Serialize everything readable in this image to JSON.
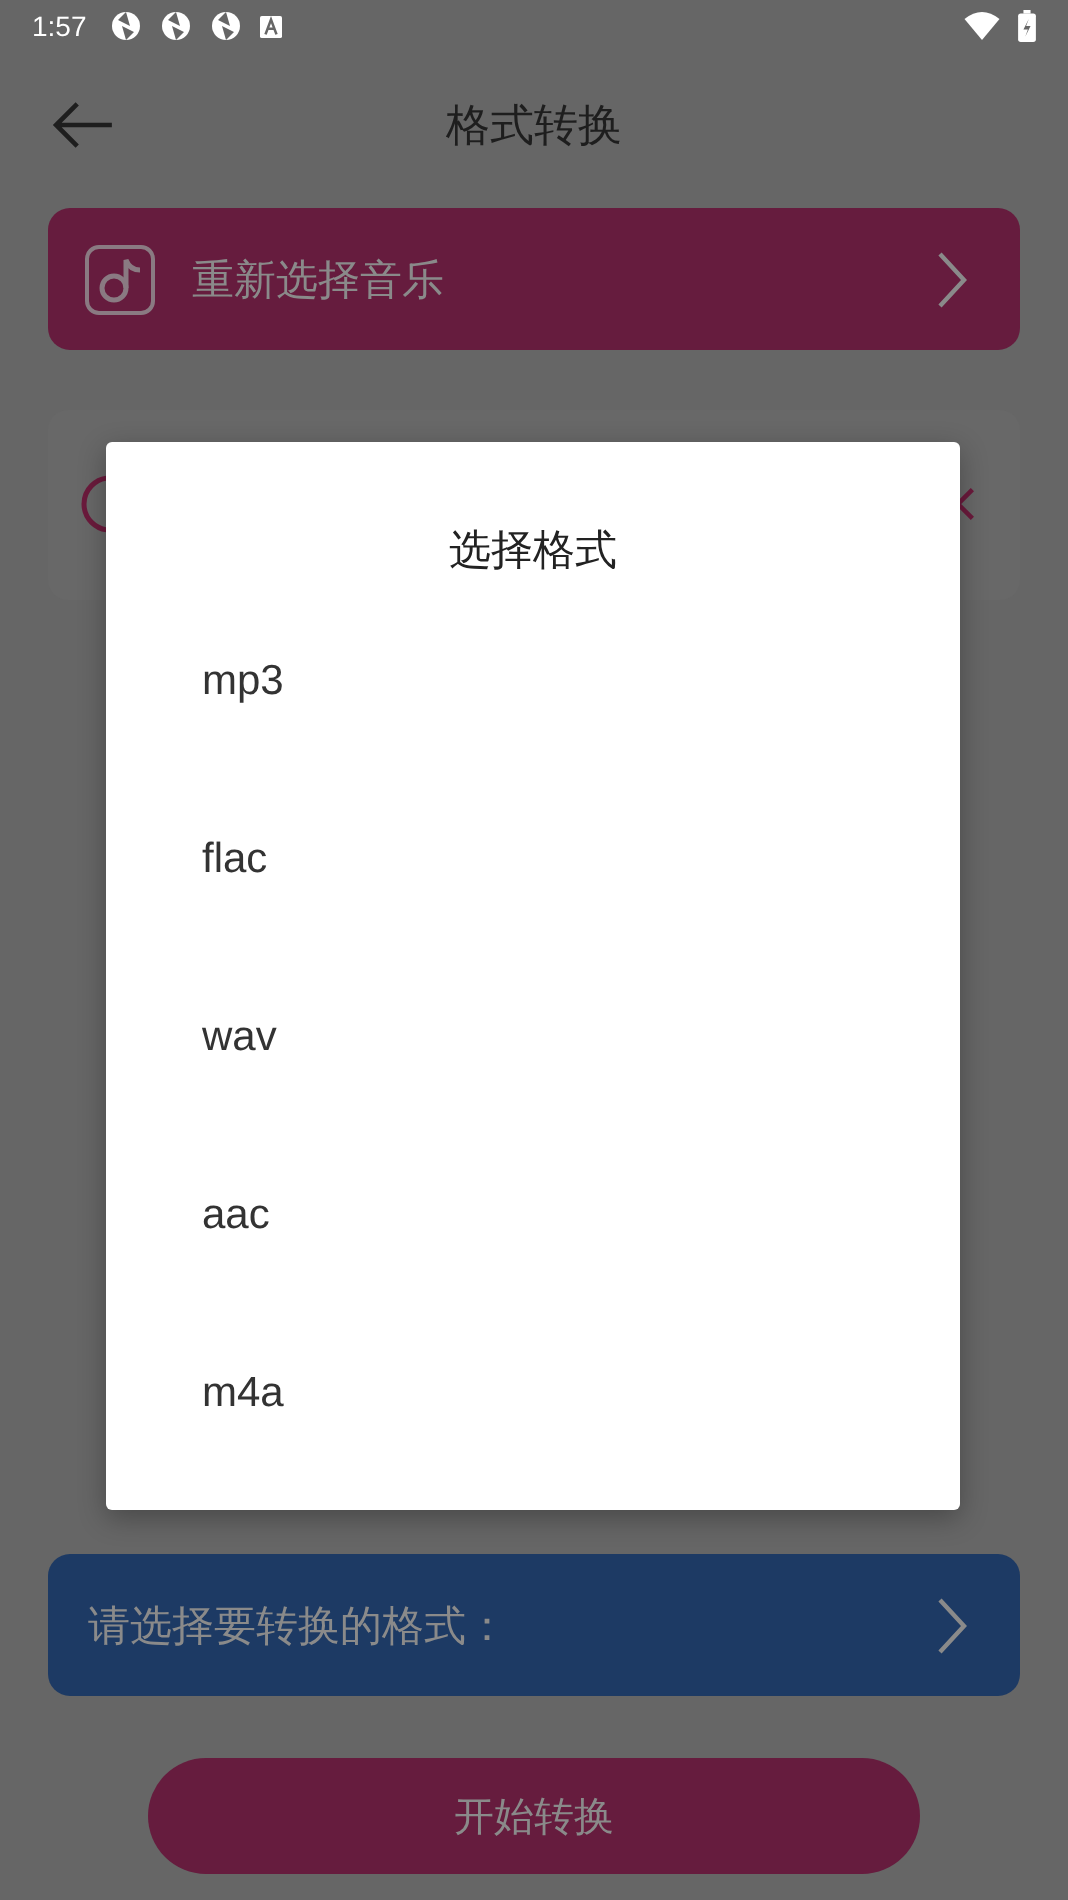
{
  "status_bar": {
    "time": "1:57"
  },
  "header": {
    "title": "格式转换"
  },
  "music_button": {
    "label": "重新选择音乐"
  },
  "format_button": {
    "label": "请选择要转换的格式："
  },
  "start_button": {
    "label": "开始转换"
  },
  "dialog": {
    "title": "选择格式",
    "options": [
      {
        "label": "mp3"
      },
      {
        "label": "flac"
      },
      {
        "label": "wav"
      },
      {
        "label": "aac"
      },
      {
        "label": "m4a"
      }
    ]
  }
}
